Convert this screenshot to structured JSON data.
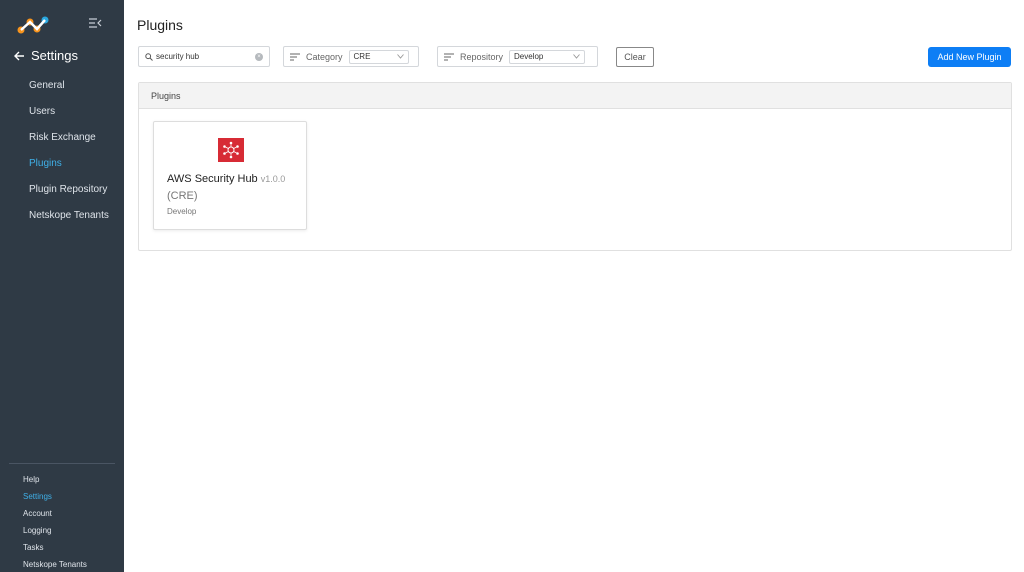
{
  "sidebar": {
    "title": "Settings",
    "items": [
      {
        "label": "General",
        "active": false
      },
      {
        "label": "Users",
        "active": false
      },
      {
        "label": "Risk Exchange",
        "active": false
      },
      {
        "label": "Plugins",
        "active": true
      },
      {
        "label": "Plugin Repository",
        "active": false
      },
      {
        "label": "Netskope Tenants",
        "active": false
      }
    ],
    "bottom_items": [
      {
        "label": "Help",
        "active": false
      },
      {
        "label": "Settings",
        "active": true
      },
      {
        "label": "Account",
        "active": false
      },
      {
        "label": "Logging",
        "active": false
      },
      {
        "label": "Tasks",
        "active": false
      },
      {
        "label": "Netskope Tenants",
        "active": false
      }
    ]
  },
  "page": {
    "title": "Plugins"
  },
  "search": {
    "value": "security hub"
  },
  "filters": {
    "category": {
      "label": "Category",
      "value": "CRE"
    },
    "repository": {
      "label": "Repository",
      "value": "Develop"
    }
  },
  "clear_label": "Clear",
  "add_label": "Add New Plugin",
  "panel": {
    "title": "Plugins"
  },
  "plugins": [
    {
      "name": "AWS Security Hub",
      "version": "v1.0.0",
      "category": "(CRE)",
      "repository": "Develop"
    }
  ],
  "colors": {
    "accent": "#0d7ef5",
    "sidebar_bg": "#2f3a45",
    "active_nav": "#3fb0e8",
    "plugin_icon": "#d72b35"
  }
}
